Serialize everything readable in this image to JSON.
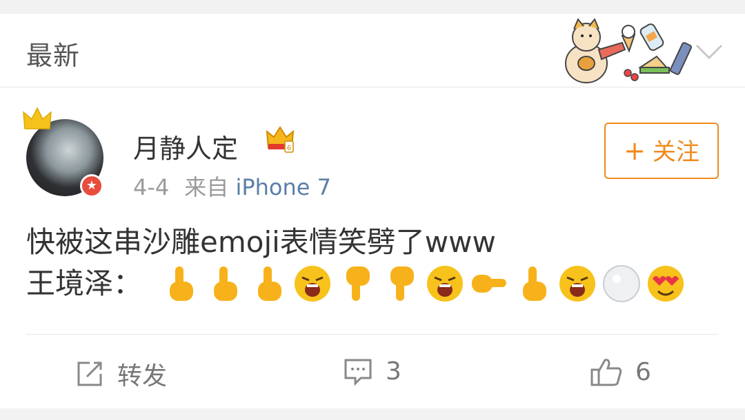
{
  "header": {
    "title": "最新"
  },
  "post": {
    "username": "月静人定",
    "date": "4-4",
    "source_prefix": "来自",
    "source": "iPhone 7",
    "follow_label": "关注",
    "follow_plus": "+",
    "text_line1": "快被这串沙雕emoji表情笑劈了www",
    "text_line2_prefix": "王境泽：",
    "emojis": [
      "point-up",
      "point-up",
      "point-up",
      "angry-shout",
      "point-down",
      "point-down",
      "angry-shout",
      "point-right",
      "point-up",
      "angry-shout",
      "rice-bowl",
      "heart-eyes"
    ]
  },
  "actions": {
    "repost_label": "转发",
    "comment_count": "3",
    "like_count": "6"
  },
  "colors": {
    "accent": "#f08a1c",
    "link": "#5b7ea8",
    "vip_badge": "#e74c3c"
  }
}
